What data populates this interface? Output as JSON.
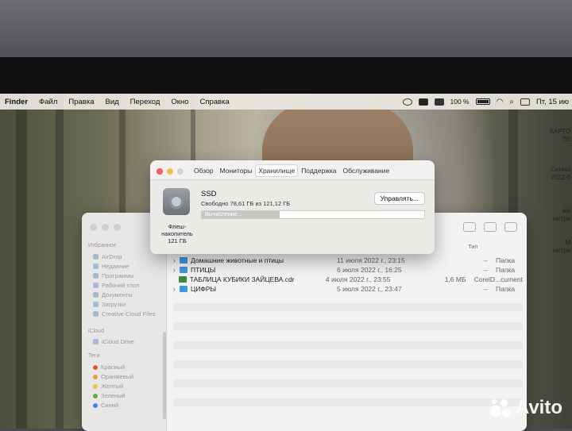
{
  "menubar": {
    "app": "Finder",
    "items": [
      "Файл",
      "Правка",
      "Вид",
      "Переход",
      "Окно",
      "Справка"
    ],
    "battery": "100 %",
    "clock": "Пт, 15 ию"
  },
  "desktop_labels": [
    "КАРТО",
    "ТЕ",
    "Снимо",
    "2022-0",
    "ми",
    "метри",
    "М",
    "метри"
  ],
  "info_window": {
    "tabs": [
      "Обзор",
      "Мониторы",
      "Хранилище",
      "Поддержка",
      "Обслуживание"
    ],
    "active_tab": "Хранилище",
    "drive_caption_1": "Флеш-",
    "drive_caption_2": "накопитель",
    "drive_caption_3": "121 ГБ",
    "drive_name": "SSD",
    "free_text": "Свободно 78,61 ГБ из 121,12 ГБ",
    "manage_label": "Управлять...",
    "progress_label": "Вычисление...",
    "progress_fraction": 0.35
  },
  "finder": {
    "sidebar": {
      "favorites_header": "Избранное",
      "favorites": [
        "AirDrop",
        "Недавние",
        "Программы",
        "Рабочий стол",
        "Документы",
        "Загрузки",
        "Creative Cloud Files"
      ],
      "icloud_header": "iCloud",
      "icloud": [
        "iCloud Drive"
      ],
      "tags_header": "Теги",
      "tags": [
        {
          "label": "Красный",
          "color": "#e0563f"
        },
        {
          "label": "Оранжевый",
          "color": "#f09a3a"
        },
        {
          "label": "Желтый",
          "color": "#e8c53a"
        },
        {
          "label": "Зеленый",
          "color": "#58b248"
        },
        {
          "label": "Синий",
          "color": "#3e8be0"
        }
      ]
    },
    "column_kind": "Тип",
    "rows": [
      {
        "name": "Домашние животные и птицы",
        "date": "11 июля 2022 г., 23:15",
        "size": "--",
        "kind": "Папка",
        "type": "folder"
      },
      {
        "name": "ПТИЦЫ",
        "date": "6 июля 2022 г., 16:25",
        "size": "--",
        "kind": "Папка",
        "type": "folder"
      },
      {
        "name": "ТАБЛИЦА КУБИКИ ЗАЙЦЕВА.cdr",
        "date": "4 июля 2022 г., 23:55",
        "size": "1,6 МБ",
        "kind": "CorelD...cument",
        "type": "file"
      },
      {
        "name": "ЦИФРЫ",
        "date": "5 июля 2022 г., 23:47",
        "size": "--",
        "kind": "Папка",
        "type": "folder"
      }
    ]
  },
  "watermark": "Avito",
  "colors": {
    "accent": "#3e9ad9",
    "close": "#ee5f57",
    "minimize": "#f5bd4f",
    "zoom": "#d0d0d0"
  }
}
